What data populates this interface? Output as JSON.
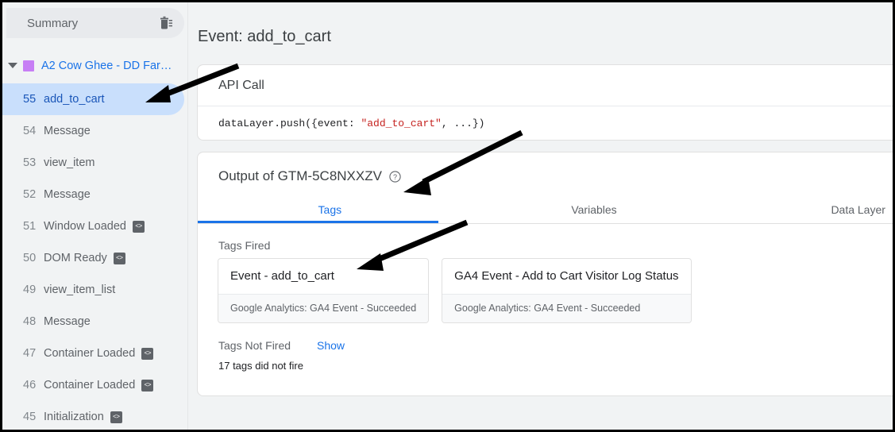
{
  "sidebar": {
    "summary": {
      "label": "Summary",
      "trash_icon": "delete-all-icon"
    },
    "container": {
      "name": "A2 Cow Ghee - DD Far…",
      "swatch_color": "#c77ef5",
      "caret_icon": "chevron-down-icon"
    },
    "events": [
      {
        "num": "55",
        "name": "add_to_cart",
        "badge": "",
        "selected": true
      },
      {
        "num": "54",
        "name": "Message",
        "badge": "",
        "selected": false
      },
      {
        "num": "53",
        "name": "view_item",
        "badge": "",
        "selected": false
      },
      {
        "num": "52",
        "name": "Message",
        "badge": "",
        "selected": false
      },
      {
        "num": "51",
        "name": "Window Loaded",
        "badge": "<>",
        "selected": false
      },
      {
        "num": "50",
        "name": "DOM Ready",
        "badge": "<>",
        "selected": false
      },
      {
        "num": "49",
        "name": "view_item_list",
        "badge": "",
        "selected": false
      },
      {
        "num": "48",
        "name": "Message",
        "badge": "",
        "selected": false
      },
      {
        "num": "47",
        "name": "Container Loaded",
        "badge": "<>",
        "selected": false
      },
      {
        "num": "46",
        "name": "Container Loaded",
        "badge": "<>",
        "selected": false
      },
      {
        "num": "45",
        "name": "Initialization",
        "badge": "<>",
        "selected": false
      }
    ]
  },
  "main": {
    "page_title": "Event: add_to_cart",
    "api_call": {
      "heading": "API Call",
      "code_prefix": "dataLayer.push({event: ",
      "code_string": "\"add_to_cart\"",
      "code_suffix": ", ...})"
    },
    "output": {
      "title": "Output of GTM-5C8NXXZV",
      "help_icon": "help-circle-icon",
      "tabs": [
        {
          "label": "Tags",
          "active": true
        },
        {
          "label": "Variables",
          "active": false
        },
        {
          "label": "Data Layer",
          "active": false
        }
      ],
      "tags_fired_label": "Tags Fired",
      "tags_fired": [
        {
          "title": "Event - add_to_cart",
          "status": "Google Analytics: GA4 Event - Succeeded"
        },
        {
          "title": "GA4 Event - Add to Cart Visitor Log Status",
          "status": "Google Analytics: GA4 Event - Succeeded"
        }
      ],
      "tags_not_fired_label": "Tags Not Fired",
      "show_link": "Show",
      "not_fired_count": "17 tags did not fire"
    }
  },
  "colors": {
    "accent": "#1a73e8",
    "selected_row": "#c9dffc",
    "page_bg": "#f1f3f4",
    "code_string": "#c5221f",
    "annotation_arrow": "#000000"
  },
  "annotations": [
    {
      "name": "arrow-to-selected-event"
    },
    {
      "name": "arrow-to-output-title"
    },
    {
      "name": "arrow-to-fired-tag"
    }
  ]
}
